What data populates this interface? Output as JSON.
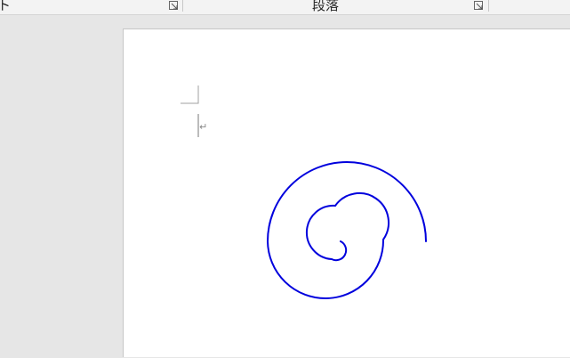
{
  "ribbon": {
    "left_group_label": "ト",
    "paragraph_group_label": "段落",
    "launcher_icon": "dialog-launcher-icon"
  },
  "document": {
    "paragraph_mark": "↵",
    "shape_type": "spiral",
    "spiral_color": "#0000dd"
  }
}
